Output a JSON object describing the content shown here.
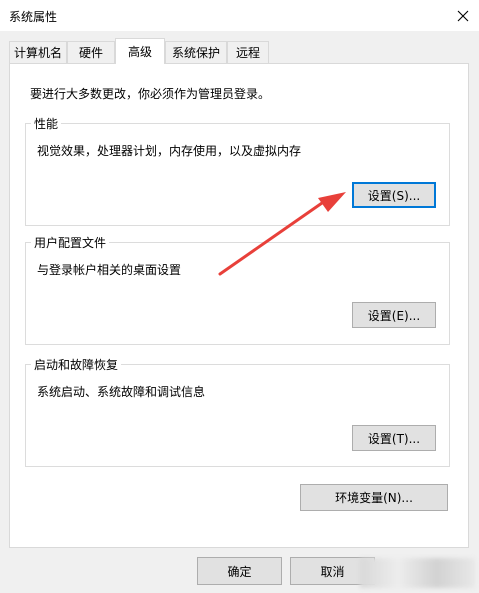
{
  "window": {
    "title": "系统属性"
  },
  "tabs": [
    {
      "label": "计算机名"
    },
    {
      "label": "硬件"
    },
    {
      "label": "高级"
    },
    {
      "label": "系统保护"
    },
    {
      "label": "远程"
    }
  ],
  "active_tab": "高级",
  "notice": "要进行大多数更改，你必须作为管理员登录。",
  "performance": {
    "title": "性能",
    "description": "视觉效果，处理器计划，内存使用，以及虚拟内存",
    "button": "设置(S)..."
  },
  "user_profiles": {
    "title": "用户配置文件",
    "description": "与登录帐户相关的桌面设置",
    "button": "设置(E)..."
  },
  "startup_recovery": {
    "title": "启动和故障恢复",
    "description": "系统启动、系统故障和调试信息",
    "button": "设置(T)..."
  },
  "env_button": "环境变量(N)...",
  "footer": {
    "ok": "确定",
    "cancel": "取消"
  },
  "colors": {
    "annotation_arrow": "#e8403a",
    "focus_border": "#0078d7"
  }
}
